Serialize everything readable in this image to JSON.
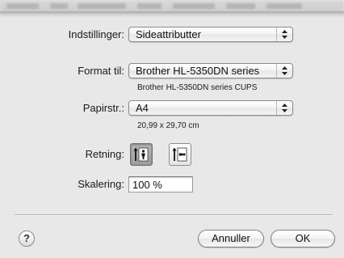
{
  "settings": {
    "label": "Indstillinger:",
    "value": "Sideattributter"
  },
  "format_for": {
    "label": "Format til:",
    "value": "Brother HL-5350DN series",
    "description": "Brother HL-5350DN series CUPS"
  },
  "paper_size": {
    "label": "Papirstr.:",
    "value": "A4",
    "dimensions": "20,99 x 29,70 cm"
  },
  "orientation": {
    "label": "Retning:",
    "options": [
      {
        "name": "portrait",
        "icon": "portrait-orientation-icon",
        "selected": true
      },
      {
        "name": "landscape",
        "icon": "landscape-orientation-icon",
        "selected": false
      }
    ]
  },
  "scale": {
    "label": "Skalering:",
    "value": "100 %"
  },
  "buttons": {
    "help": "?",
    "cancel": "Annuller",
    "ok": "OK"
  }
}
